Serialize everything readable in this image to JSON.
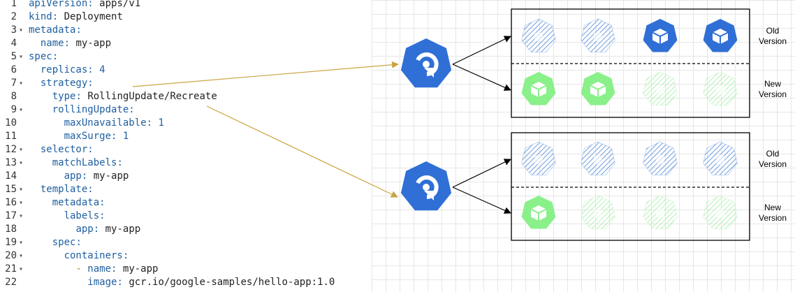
{
  "editor": {
    "lines": [
      {
        "n": "1",
        "fold": "",
        "indent": "",
        "key": "apiVersion",
        "value": "apps/v1"
      },
      {
        "n": "2",
        "fold": "",
        "indent": "",
        "key": "kind",
        "value": "Deployment"
      },
      {
        "n": "3",
        "fold": "▾",
        "indent": "",
        "key": "metadata",
        "value": ""
      },
      {
        "n": "4",
        "fold": "",
        "indent": "  ",
        "key": "name",
        "value": "my-app"
      },
      {
        "n": "5",
        "fold": "▾",
        "indent": "",
        "key": "spec",
        "value": ""
      },
      {
        "n": "6",
        "fold": "",
        "indent": "  ",
        "key": "replicas",
        "value": "4"
      },
      {
        "n": "7",
        "fold": "▾",
        "indent": "  ",
        "key": "strategy",
        "value": ""
      },
      {
        "n": "8",
        "fold": "",
        "indent": "    ",
        "key": "type",
        "value": "RollingUpdate/Recreate"
      },
      {
        "n": "9",
        "fold": "▾",
        "indent": "    ",
        "key": "rollingUpdate",
        "value": ""
      },
      {
        "n": "10",
        "fold": "",
        "indent": "      ",
        "key": "maxUnavailable",
        "value": "1"
      },
      {
        "n": "11",
        "fold": "",
        "indent": "      ",
        "key": "maxSurge",
        "value": "1"
      },
      {
        "n": "12",
        "fold": "▾",
        "indent": "  ",
        "key": "selector",
        "value": ""
      },
      {
        "n": "13",
        "fold": "▾",
        "indent": "    ",
        "key": "matchLabels",
        "value": ""
      },
      {
        "n": "14",
        "fold": "",
        "indent": "      ",
        "key": "app",
        "value": "my-app"
      },
      {
        "n": "15",
        "fold": "▾",
        "indent": "  ",
        "key": "template",
        "value": ""
      },
      {
        "n": "16",
        "fold": "▾",
        "indent": "    ",
        "key": "metadata",
        "value": ""
      },
      {
        "n": "17",
        "fold": "▾",
        "indent": "      ",
        "key": "labels",
        "value": ""
      },
      {
        "n": "18",
        "fold": "",
        "indent": "        ",
        "key": "app",
        "value": "my-app"
      },
      {
        "n": "19",
        "fold": "▾",
        "indent": "    ",
        "key": "spec",
        "value": ""
      },
      {
        "n": "20",
        "fold": "▾",
        "indent": "      ",
        "key": "containers",
        "value": ""
      },
      {
        "n": "21",
        "fold": "▾",
        "indent": "        ",
        "key": "name",
        "value": "my-app",
        "dash": true
      },
      {
        "n": "22",
        "fold": "",
        "indent": "          ",
        "key": "image",
        "value": "gcr.io/google-samples/hello-app:1.0"
      }
    ]
  },
  "diagram": {
    "colors": {
      "k8s_blue": "#2f6fd6",
      "new_green": "#8af08a",
      "connector": "#c9a440",
      "faded_blue": "#6f9ee0",
      "faded_green": "#b4f0b4"
    },
    "top_box": {
      "old_label": "Old\nVersion",
      "new_label": "New\nVersion",
      "old_pods": [
        "terminated",
        "terminated",
        "running",
        "running"
      ],
      "new_pods": [
        "running",
        "running",
        "pending",
        "pending"
      ]
    },
    "bottom_box": {
      "old_label": "Old\nVersion",
      "new_label": "New\nVersion",
      "old_pods": [
        "terminated",
        "terminated",
        "terminated",
        "terminated"
      ],
      "new_pods": [
        "running",
        "pending",
        "pending",
        "pending"
      ]
    },
    "icons": {
      "deployment_icon": "k8s-deployment-icon",
      "pod_icon": "k8s-pod-icon"
    }
  }
}
